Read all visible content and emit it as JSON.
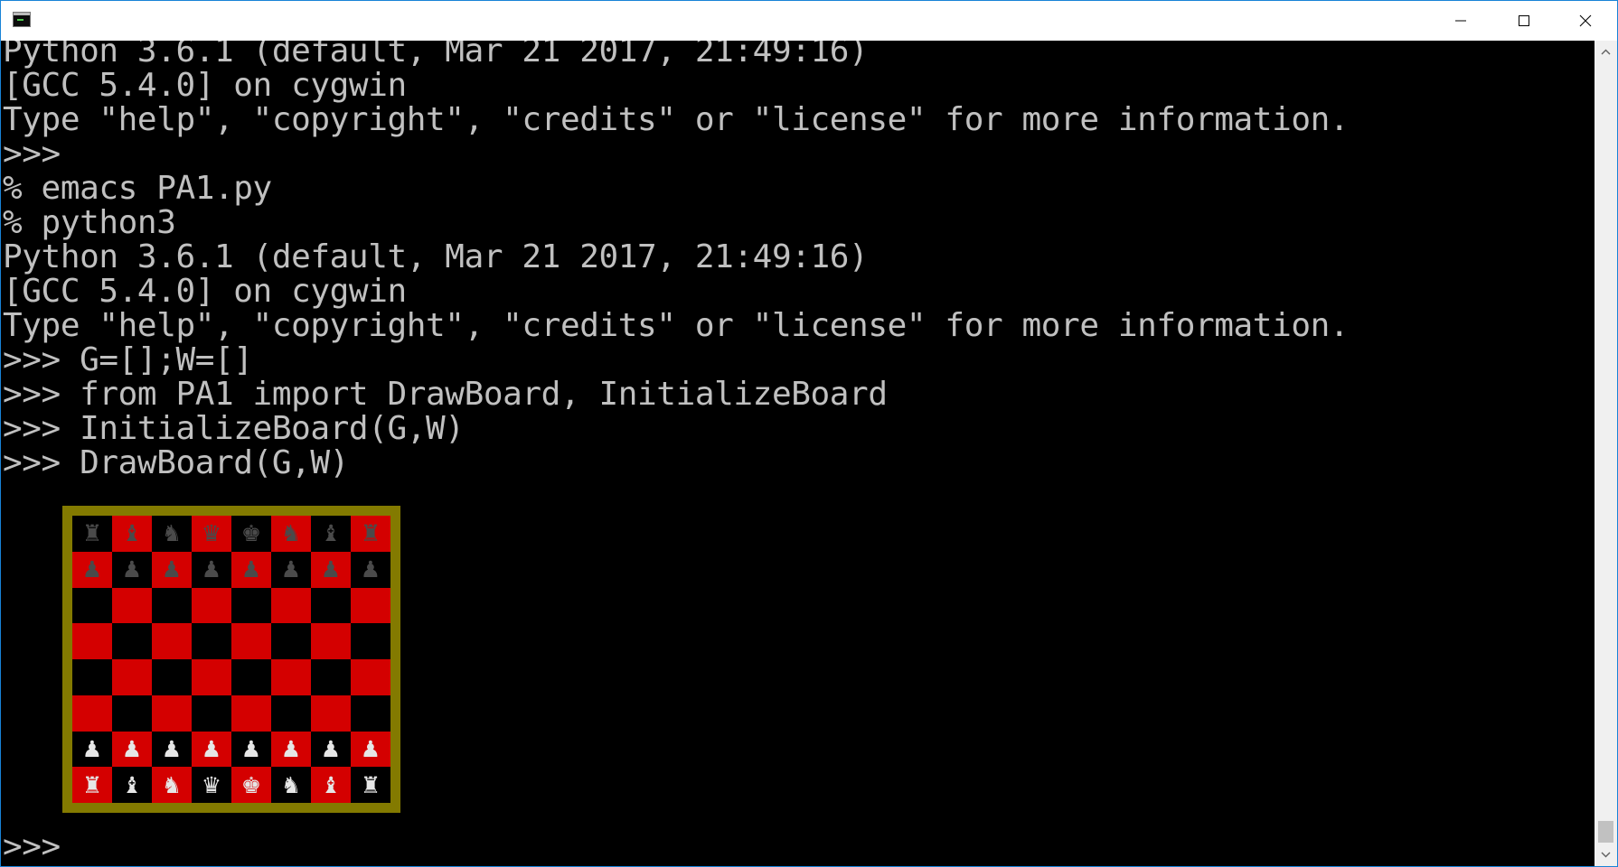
{
  "window": {
    "icon": "console-app-icon",
    "controls": [
      "minimize-icon",
      "maximize-icon",
      "close-icon"
    ]
  },
  "console": {
    "lines": [
      "Python 3.6.1 (default, Mar 21 2017, 21:49:16)",
      "[GCC 5.4.0] on cygwin",
      "Type \"help\", \"copyright\", \"credits\" or \"license\" for more information.",
      ">>>",
      "% emacs PA1.py",
      "% python3",
      "Python 3.6.1 (default, Mar 21 2017, 21:49:16)",
      "[GCC 5.4.0] on cygwin",
      "Type \"help\", \"copyright\", \"credits\" or \"license\" for more information.",
      ">>> G=[];W=[]",
      ">>> from PA1 import DrawBoard, InitializeBoard",
      ">>> InitializeBoard(G,W)",
      ">>> DrawBoard(G,W)"
    ],
    "prompt": ">>>"
  },
  "board": {
    "colors": {
      "frame": "#837a00",
      "red": "#d40000",
      "black": "#000000",
      "black_piece": "#4a4a4a",
      "white_piece": "#e6e6e6"
    },
    "rows": [
      [
        [
          "♜",
          "b"
        ],
        [
          "♝",
          "b"
        ],
        [
          "♞",
          "b"
        ],
        [
          "♛",
          "b"
        ],
        [
          "♚",
          "b"
        ],
        [
          "♞",
          "b"
        ],
        [
          "♝",
          "b"
        ],
        [
          "♜",
          "b"
        ]
      ],
      [
        [
          "♟",
          "b"
        ],
        [
          "♟",
          "b"
        ],
        [
          "♟",
          "b"
        ],
        [
          "♟",
          "b"
        ],
        [
          "♟",
          "b"
        ],
        [
          "♟",
          "b"
        ],
        [
          "♟",
          "b"
        ],
        [
          "♟",
          "b"
        ]
      ],
      [
        [
          "",
          ""
        ],
        [
          "",
          ""
        ],
        [
          "",
          ""
        ],
        [
          "",
          ""
        ],
        [
          "",
          ""
        ],
        [
          "",
          ""
        ],
        [
          "",
          ""
        ],
        [
          "",
          ""
        ]
      ],
      [
        [
          "",
          ""
        ],
        [
          "",
          ""
        ],
        [
          "",
          ""
        ],
        [
          "",
          ""
        ],
        [
          "",
          ""
        ],
        [
          "",
          ""
        ],
        [
          "",
          ""
        ],
        [
          "",
          ""
        ]
      ],
      [
        [
          "",
          ""
        ],
        [
          "",
          ""
        ],
        [
          "",
          ""
        ],
        [
          "",
          ""
        ],
        [
          "",
          ""
        ],
        [
          "",
          ""
        ],
        [
          "",
          ""
        ],
        [
          "",
          ""
        ]
      ],
      [
        [
          "",
          ""
        ],
        [
          "",
          ""
        ],
        [
          "",
          ""
        ],
        [
          "",
          ""
        ],
        [
          "",
          ""
        ],
        [
          "",
          ""
        ],
        [
          "",
          ""
        ],
        [
          "",
          ""
        ]
      ],
      [
        [
          "♟",
          "w"
        ],
        [
          "♟",
          "w"
        ],
        [
          "♟",
          "w"
        ],
        [
          "♟",
          "w"
        ],
        [
          "♟",
          "w"
        ],
        [
          "♟",
          "w"
        ],
        [
          "♟",
          "w"
        ],
        [
          "♟",
          "w"
        ]
      ],
      [
        [
          "♜",
          "w"
        ],
        [
          "♝",
          "w"
        ],
        [
          "♞",
          "w"
        ],
        [
          "♛",
          "w"
        ],
        [
          "♚",
          "w"
        ],
        [
          "♞",
          "w"
        ],
        [
          "♝",
          "w"
        ],
        [
          "♜",
          "w"
        ]
      ]
    ]
  },
  "scrollbar": {
    "up_icon": "scroll-up-arrow-icon",
    "down_icon": "scroll-down-arrow-icon"
  }
}
